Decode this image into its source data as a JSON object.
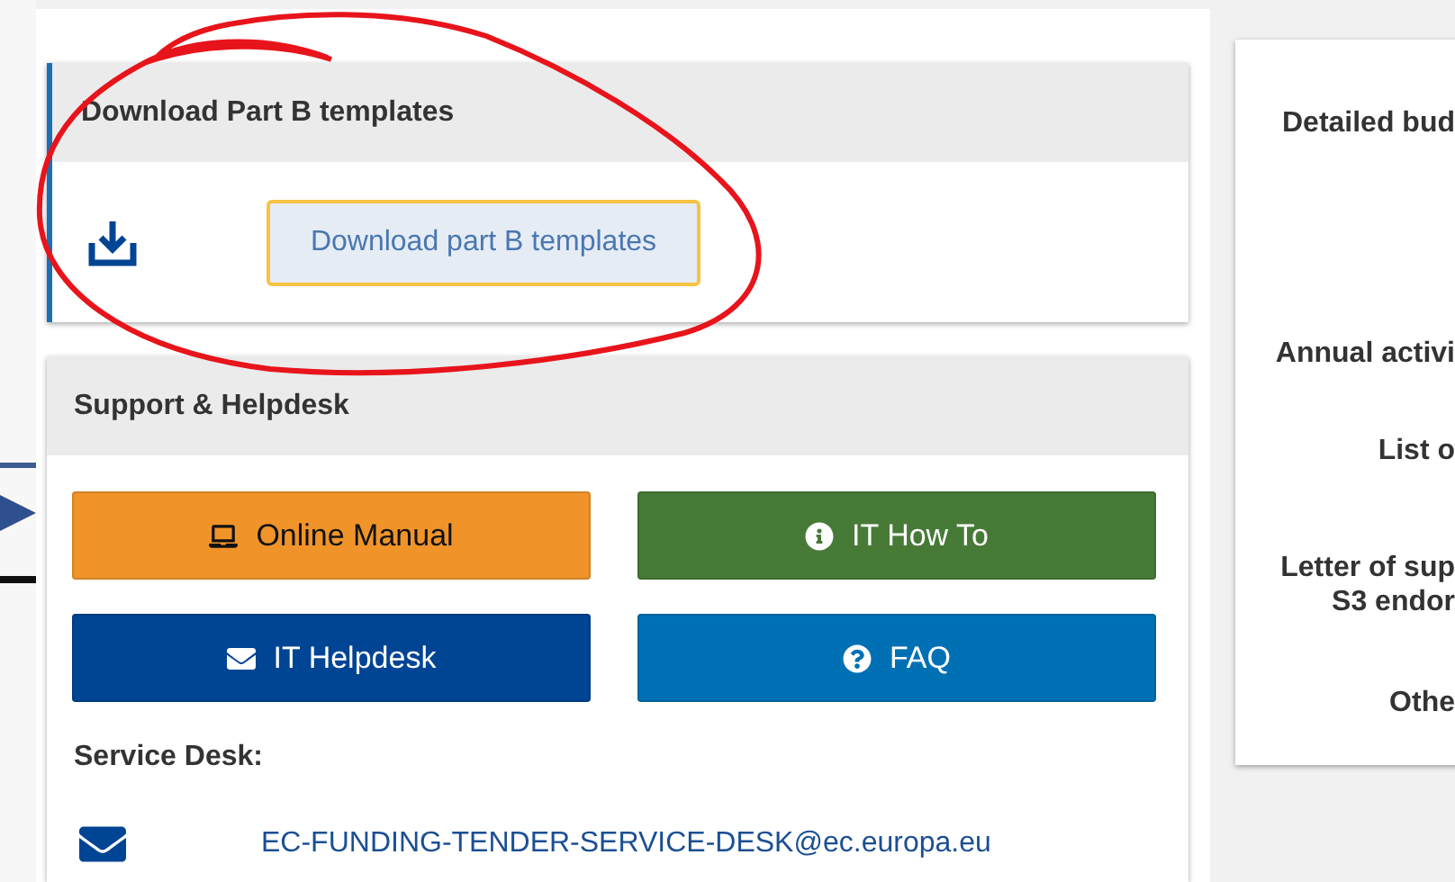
{
  "templates_card": {
    "title": "Download Part B templates",
    "button": "Download part B templates"
  },
  "support_card": {
    "title": "Support & Helpdesk",
    "buttons": [
      {
        "kind": "manual",
        "label": "Online Manual"
      },
      {
        "kind": "howto",
        "label": "IT How To"
      },
      {
        "kind": "helpdesk",
        "label": "IT Helpdesk"
      },
      {
        "kind": "faq",
        "label": "FAQ"
      }
    ],
    "service_desk_label": "Service Desk:",
    "email": "EC-FUNDING-TENDER-SERVICE-DESK@ec.europa.eu"
  },
  "documents_panel": {
    "items": [
      {
        "lines": [
          "Detailed bud"
        ]
      },
      {
        "lines": [
          "Annual activi"
        ]
      },
      {
        "lines": [
          "List o"
        ]
      },
      {
        "lines": [
          "Letter of sup",
          "S3 endor"
        ]
      },
      {
        "lines": [
          "Othe"
        ]
      }
    ]
  }
}
